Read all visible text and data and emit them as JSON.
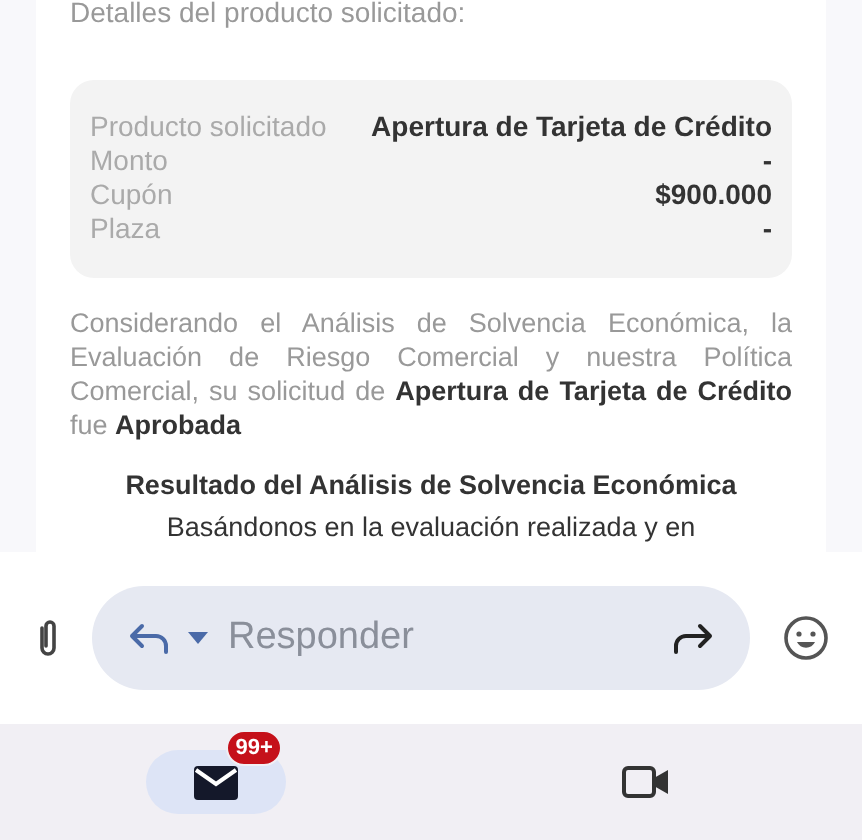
{
  "email": {
    "intro": "Detalles del producto solicitado:",
    "details": [
      {
        "label": "Producto solicitado",
        "value": "Apertura de Tarjeta de Crédito"
      },
      {
        "label": "Monto",
        "value": "-"
      },
      {
        "label": "Cupón",
        "value": "$900.000"
      },
      {
        "label": "Plaza",
        "value": "-"
      }
    ],
    "paragraph": "Considerando el Análisis de Solvencia Económica, la Evaluación de Riesgo Comercial y nuestra Política Comercial, su solicitud de **Apertura de Tarjeta de Crédito** fue **Aprobada**",
    "heading": "Resultado del Análisis de Solvencia Económica",
    "body_start": "Basándonos en la evaluación realizada y en"
  },
  "compose": {
    "placeholder": "Responder"
  },
  "nav": [
    {
      "kind": "mail",
      "selected": true,
      "badge": "99+"
    },
    {
      "kind": "video",
      "selected": false
    }
  ]
}
